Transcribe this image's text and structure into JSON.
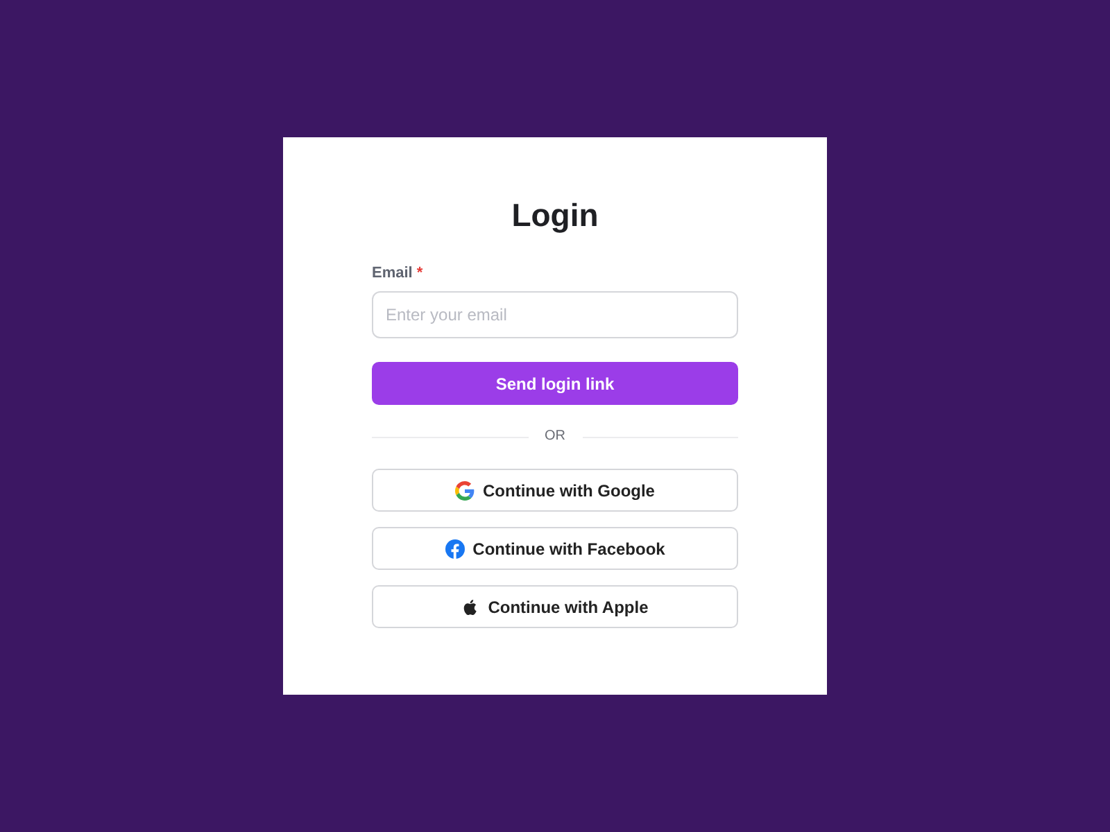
{
  "title": "Login",
  "email_field": {
    "label": "Email",
    "required": true,
    "required_mark": "*",
    "placeholder": "Enter your email"
  },
  "submit_button": "Send login link",
  "divider": "OR",
  "providers": [
    {
      "kind": "google",
      "label": "Continue with Google"
    },
    {
      "kind": "facebook",
      "label": "Continue with Facebook"
    },
    {
      "kind": "apple",
      "label": "Continue with Apple"
    }
  ]
}
